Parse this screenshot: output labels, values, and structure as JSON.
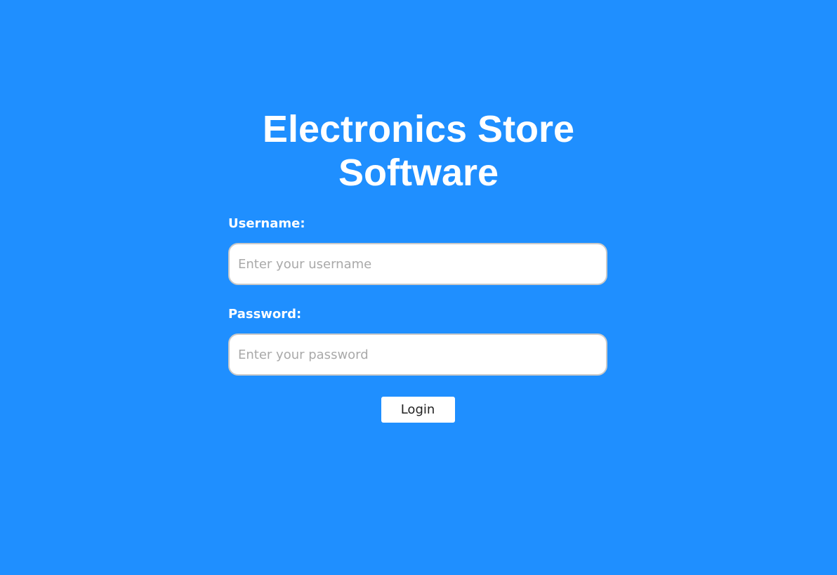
{
  "app": {
    "title_line1": "Electronics Store",
    "title_line2": "Software"
  },
  "login_form": {
    "username_label": "Username:",
    "username_placeholder": "Enter your username",
    "username_value": "",
    "password_label": "Password:",
    "password_placeholder": "Enter your password",
    "password_value": "",
    "login_label": "Login"
  },
  "colors": {
    "background": "#1f8fff",
    "text": "#ffffff",
    "input_border": "#c9c9c9",
    "button_background": "#ffffff"
  }
}
